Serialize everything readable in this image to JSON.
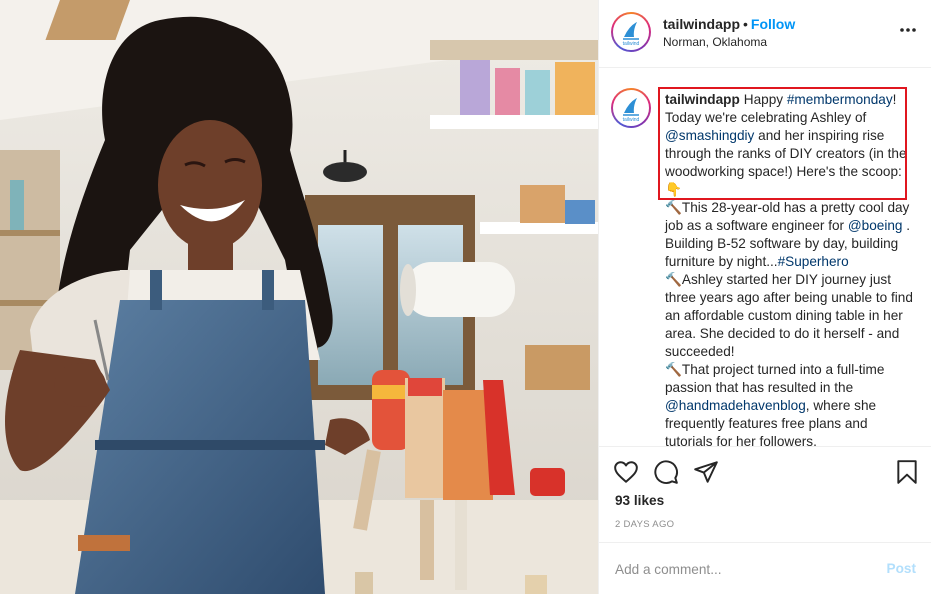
{
  "post": {
    "username": "tailwindapp",
    "separator": "•",
    "follow_label": "Follow",
    "location": "Norman, Oklahoma",
    "more_icon": "more-horizontal-icon"
  },
  "caption": {
    "username": "tailwindapp",
    "p1": "Happy ",
    "h1": "#membermonday",
    "p2": "! Today we're celebrating Ashley of ",
    "m1": "@smashingdiy",
    "p3": " and her inspiring rise through the ranks of DIY creators (in the woodworking space!) Here's the scoop: 👇",
    "p4": "🔨This 28-year-old has a pretty cool day job as a software engineer for ",
    "m2": "@boeing",
    "p5": " . Building B-52 software by day, building furniture by night...",
    "h2": "#Superhero",
    "p6": "🔨Ashley started her DIY journey just three years ago after being unable to find an affordable custom dining table in her area. She decided to do it herself - and succeeded!",
    "p7": "🔨That project turned into a full-time passion that has resulted in the ",
    "m3": "@handmadehavenblog",
    "p8": ", where she frequently features free plans and tutorials for her followers."
  },
  "actions": {
    "like_icon": "heart-icon",
    "comment_icon": "comment-icon",
    "share_icon": "send-icon",
    "save_icon": "bookmark-icon",
    "likes": "93 likes",
    "time": "2 DAYS AGO"
  },
  "comment_box": {
    "placeholder": "Add a comment...",
    "post_label": "Post"
  },
  "colors": {
    "link": "#00376b",
    "follow": "#0095f6",
    "highlight_box": "#e0161f",
    "post_disabled": "#b2dffc"
  }
}
